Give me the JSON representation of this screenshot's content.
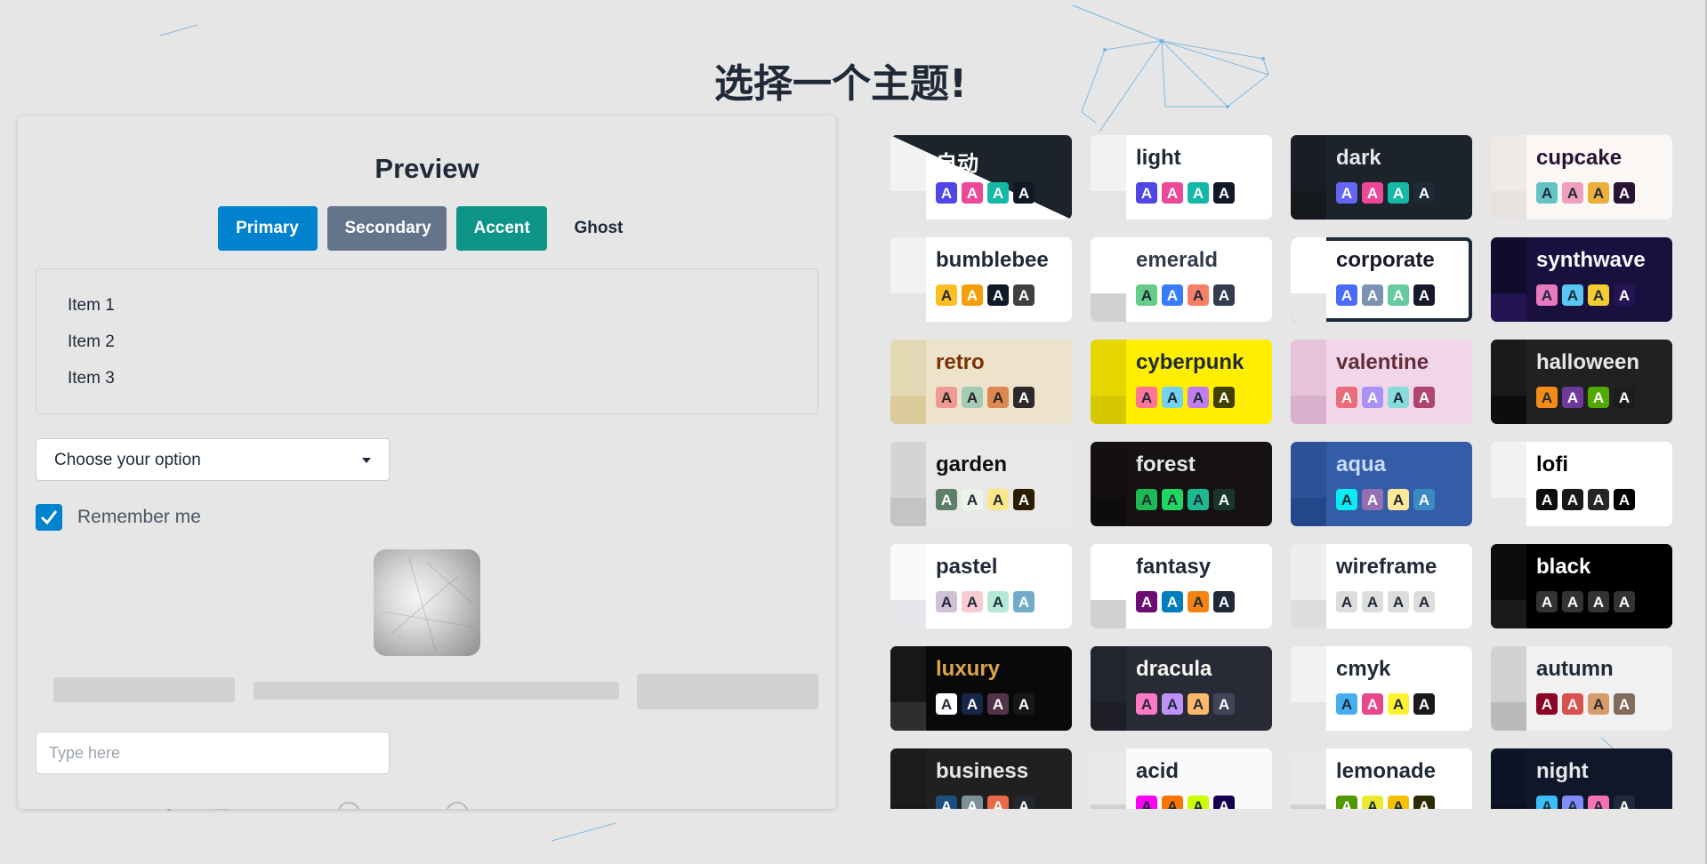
{
  "page_title": "选择一个主题!",
  "preview": {
    "title": "Preview",
    "buttons": {
      "primary": "Primary",
      "secondary": "Secondary",
      "accent": "Accent",
      "ghost": "Ghost"
    },
    "items": [
      "Item 1",
      "Item 2",
      "Item 3"
    ],
    "select": {
      "value": "Choose your option"
    },
    "checkbox": {
      "label": "Remember me",
      "checked": true
    },
    "input": {
      "placeholder": "Type here"
    }
  },
  "swatch_glyph": "A",
  "themes": [
    {
      "name": "自动",
      "bg": "#ffffff",
      "fg": "#ffffff",
      "a": "#f2f2f2",
      "b": "#e5e5e5",
      "auto": true,
      "sw": [
        [
          "#4f46e5",
          "#fff"
        ],
        [
          "#ec4899",
          "#fff"
        ],
        [
          "#14b8a6",
          "#fff"
        ],
        [
          "#111827",
          "#fff"
        ]
      ]
    },
    {
      "name": "light",
      "bg": "#ffffff",
      "fg": "#1f2937",
      "a": "#f2f2f2",
      "b": "#e5e5e5",
      "sw": [
        [
          "#4f46e5",
          "#fff"
        ],
        [
          "#ec4899",
          "#fff"
        ],
        [
          "#14b8a6",
          "#fff"
        ],
        [
          "#111827",
          "#fff"
        ]
      ]
    },
    {
      "name": "dark",
      "bg": "#1d232a",
      "fg": "#e5e7eb",
      "a": "#191e24",
      "b": "#15191e",
      "sw": [
        [
          "#6366f1",
          "#fff"
        ],
        [
          "#ec4899",
          "#fff"
        ],
        [
          "#14b8a6",
          "#fff"
        ],
        [
          "#1f2937",
          "#fff"
        ]
      ]
    },
    {
      "name": "cupcake",
      "bg": "#faf7f5",
      "fg": "#291334",
      "a": "#efeae6",
      "b": "#e7e2df",
      "sw": [
        [
          "#65c3c8",
          "#1f2937"
        ],
        [
          "#ef9fbc",
          "#1f2937"
        ],
        [
          "#eeaf3a",
          "#1f2937"
        ],
        [
          "#291334",
          "#fff"
        ]
      ]
    },
    {
      "name": "bumblebee",
      "bg": "#ffffff",
      "fg": "#1f2937",
      "a": "#f2f2f2",
      "b": "#e5e5e5",
      "sw": [
        [
          "#fbbf24",
          "#1f2937"
        ],
        [
          "#f59e0b",
          "#fff"
        ],
        [
          "#111827",
          "#fff"
        ],
        [
          "#404040",
          "#fff"
        ]
      ]
    },
    {
      "name": "emerald",
      "bg": "#ffffff",
      "fg": "#333c4d",
      "a": "#ffffff",
      "b": "#d1d1d1",
      "sw": [
        [
          "#66cc8a",
          "#1f2937"
        ],
        [
          "#377cfb",
          "#fff"
        ],
        [
          "#f68067",
          "#1f2937"
        ],
        [
          "#333c4d",
          "#fff"
        ]
      ]
    },
    {
      "name": "corporate",
      "bg": "#ffffff",
      "fg": "#181a2a",
      "a": "#ffffff",
      "b": "#e5e6e6",
      "selected": true,
      "sw": [
        [
          "#4b6bfb",
          "#fff"
        ],
        [
          "#7b92b2",
          "#fff"
        ],
        [
          "#67cba0",
          "#fff"
        ],
        [
          "#181a2a",
          "#fff"
        ]
      ]
    },
    {
      "name": "synthwave",
      "bg": "#1a103d",
      "fg": "#f9f7fd",
      "a": "#120b2c",
      "b": "#221551",
      "sw": [
        [
          "#e779c1",
          "#1f2937"
        ],
        [
          "#58c7f3",
          "#1f2937"
        ],
        [
          "#f3cc30",
          "#1f2937"
        ],
        [
          "#221551",
          "#fff"
        ]
      ]
    },
    {
      "name": "retro",
      "bg": "#ece3ca",
      "fg": "#793205",
      "a": "#e4d8b4",
      "b": "#dbca9a",
      "sw": [
        [
          "#ef9995",
          "#282425"
        ],
        [
          "#a4cbb4",
          "#282425"
        ],
        [
          "#dc8850",
          "#282425"
        ],
        [
          "#2e282a",
          "#fff"
        ]
      ]
    },
    {
      "name": "cyberpunk",
      "bg": "#ffee00",
      "fg": "#1f2937",
      "a": "#e5d600",
      "b": "#d6c800",
      "sw": [
        [
          "#ff7598",
          "#1f2937"
        ],
        [
          "#75d1f0",
          "#1f2937"
        ],
        [
          "#c07eec",
          "#1f2937"
        ],
        [
          "#423f00",
          "#fff"
        ]
      ]
    },
    {
      "name": "valentine",
      "bg": "#f0d6e8",
      "fg": "#632c3b",
      "a": "#e6c3da",
      "b": "#dbb0cc",
      "sw": [
        [
          "#e96d7b",
          "#fff"
        ],
        [
          "#a991f7",
          "#fff"
        ],
        [
          "#88dbdd",
          "#1f2937"
        ],
        [
          "#af4670",
          "#fff"
        ]
      ]
    },
    {
      "name": "halloween",
      "bg": "#212121",
      "fg": "#e5e7eb",
      "a": "#1a1a1a",
      "b": "#0d0d0d",
      "sw": [
        [
          "#f28c18",
          "#1f2937"
        ],
        [
          "#6d3a9c",
          "#fff"
        ],
        [
          "#51a800",
          "#fff"
        ],
        [
          "#1b1d1d",
          "#fff"
        ]
      ]
    },
    {
      "name": "garden",
      "bg": "#e9e7e7",
      "fg": "#100f0f",
      "a": "#d4d4d4",
      "b": "#c4c4c4",
      "sw": [
        [
          "#5c7f67",
          "#fff"
        ],
        [
          "#ecf4e7",
          "#1f2937"
        ],
        [
          "#fde68a",
          "#1f2937"
        ],
        [
          "#291e00",
          "#fff"
        ]
      ]
    },
    {
      "name": "forest",
      "bg": "#171212",
      "fg": "#e5e7eb",
      "a": "#141010",
      "b": "#0f0c0c",
      "sw": [
        [
          "#1eb854",
          "#1f2937"
        ],
        [
          "#1fd65f",
          "#1f2937"
        ],
        [
          "#1db990",
          "#1f2937"
        ],
        [
          "#19362d",
          "#fff"
        ]
      ]
    },
    {
      "name": "aqua",
      "bg": "#345da7",
      "fg": "#c6dbff",
      "a": "#2d5299",
      "b": "#24468a",
      "sw": [
        [
          "#09ecf3",
          "#1f2937"
        ],
        [
          "#966fb3",
          "#fff"
        ],
        [
          "#ffe999",
          "#1f2937"
        ],
        [
          "#3b8ac4",
          "#fff"
        ]
      ]
    },
    {
      "name": "lofi",
      "bg": "#ffffff",
      "fg": "#000000",
      "a": "#f2f2f2",
      "b": "#e6e6e6",
      "sw": [
        [
          "#0d0d0d",
          "#fff"
        ],
        [
          "#1a1919",
          "#fff"
        ],
        [
          "#262626",
          "#fff"
        ],
        [
          "#000000",
          "#fff"
        ]
      ]
    },
    {
      "name": "pastel",
      "bg": "#ffffff",
      "fg": "#1f2937",
      "a": "#f9fafb",
      "b": "#e5e7eb",
      "sw": [
        [
          "#d1c1d7",
          "#1f2937"
        ],
        [
          "#f6cbd1",
          "#1f2937"
        ],
        [
          "#b4e9d6",
          "#1f2937"
        ],
        [
          "#70acc7",
          "#fff"
        ]
      ]
    },
    {
      "name": "fantasy",
      "bg": "#ffffff",
      "fg": "#1f2937",
      "a": "#ffffff",
      "b": "#d1d1d1",
      "sw": [
        [
          "#6e0b75",
          "#fff"
        ],
        [
          "#007ebd",
          "#fff"
        ],
        [
          "#f6830f",
          "#1f2937"
        ],
        [
          "#1f2937",
          "#fff"
        ]
      ]
    },
    {
      "name": "wireframe",
      "bg": "#ffffff",
      "fg": "#1f2937",
      "a": "#eeeeee",
      "b": "#dddddd",
      "sw": [
        [
          "#dddddd",
          "#1f2937"
        ],
        [
          "#dddddd",
          "#1f2937"
        ],
        [
          "#dddddd",
          "#1f2937"
        ],
        [
          "#dddddd",
          "#1f2937"
        ]
      ]
    },
    {
      "name": "black",
      "bg": "#000000",
      "fg": "#ffffff",
      "a": "#0d0d0d",
      "b": "#1a1a1a",
      "sw": [
        [
          "#343232",
          "#fff"
        ],
        [
          "#343232",
          "#fff"
        ],
        [
          "#343232",
          "#fff"
        ],
        [
          "#343232",
          "#fff"
        ]
      ]
    },
    {
      "name": "luxury",
      "bg": "#09090b",
      "fg": "#dca54c",
      "a": "#171618",
      "b": "#2e2d2f",
      "sw": [
        [
          "#ffffff",
          "#1f2937"
        ],
        [
          "#152747",
          "#fff"
        ],
        [
          "#513448",
          "#fff"
        ],
        [
          "#171618",
          "#fff"
        ]
      ]
    },
    {
      "name": "dracula",
      "bg": "#282a36",
      "fg": "#f8f8f2",
      "a": "#22242e",
      "b": "#1d1e26",
      "sw": [
        [
          "#ff79c6",
          "#1f2937"
        ],
        [
          "#bd93f9",
          "#1f2937"
        ],
        [
          "#ffb86c",
          "#1f2937"
        ],
        [
          "#414558",
          "#fff"
        ]
      ]
    },
    {
      "name": "cmyk",
      "bg": "#ffffff",
      "fg": "#1f2937",
      "a": "#f2f2f2",
      "b": "#e5e5e5",
      "sw": [
        [
          "#45aeee",
          "#1f2937"
        ],
        [
          "#e8488a",
          "#fff"
        ],
        [
          "#fff232",
          "#1f2937"
        ],
        [
          "#1a1a1a",
          "#fff"
        ]
      ]
    },
    {
      "name": "autumn",
      "bg": "#f1f1f1",
      "fg": "#1f2937",
      "a": "#d1d1d1",
      "b": "#bababa",
      "sw": [
        [
          "#8c0327",
          "#fff"
        ],
        [
          "#d85251",
          "#fff"
        ],
        [
          "#d59b6a",
          "#1f2937"
        ],
        [
          "#826a5c",
          "#fff"
        ]
      ]
    },
    {
      "name": "business",
      "bg": "#202020",
      "fg": "#e5e7eb",
      "a": "#1c1c1c",
      "b": "#181818",
      "sw": [
        [
          "#1c4e80",
          "#fff"
        ],
        [
          "#7c909a",
          "#fff"
        ],
        [
          "#ea6947",
          "#fff"
        ],
        [
          "#23282e",
          "#fff"
        ]
      ]
    },
    {
      "name": "acid",
      "bg": "#fafafa",
      "fg": "#1f2937",
      "a": "#e8e8e8",
      "b": "#d1d1d1",
      "sw": [
        [
          "#ff00f4",
          "#1f2937"
        ],
        [
          "#ff7400",
          "#1f2937"
        ],
        [
          "#cbfd03",
          "#1f2937"
        ],
        [
          "#140050",
          "#fff"
        ]
      ]
    },
    {
      "name": "lemonade",
      "bg": "#ffffff",
      "fg": "#1f2937",
      "a": "#e9e7e7",
      "b": "#d1d1d1",
      "sw": [
        [
          "#519903",
          "#fff"
        ],
        [
          "#e9e92f",
          "#1f2937"
        ],
        [
          "#f6c000",
          "#1f2937"
        ],
        [
          "#2c2c04",
          "#fff"
        ]
      ]
    },
    {
      "name": "night",
      "bg": "#0f1729",
      "fg": "#e5e7eb",
      "a": "#0c1425",
      "b": "#0a1020",
      "sw": [
        [
          "#38bdf8",
          "#1f2937"
        ],
        [
          "#818cf8",
          "#1f2937"
        ],
        [
          "#f471b5",
          "#1f2937"
        ],
        [
          "#1e293b",
          "#fff"
        ]
      ]
    }
  ]
}
